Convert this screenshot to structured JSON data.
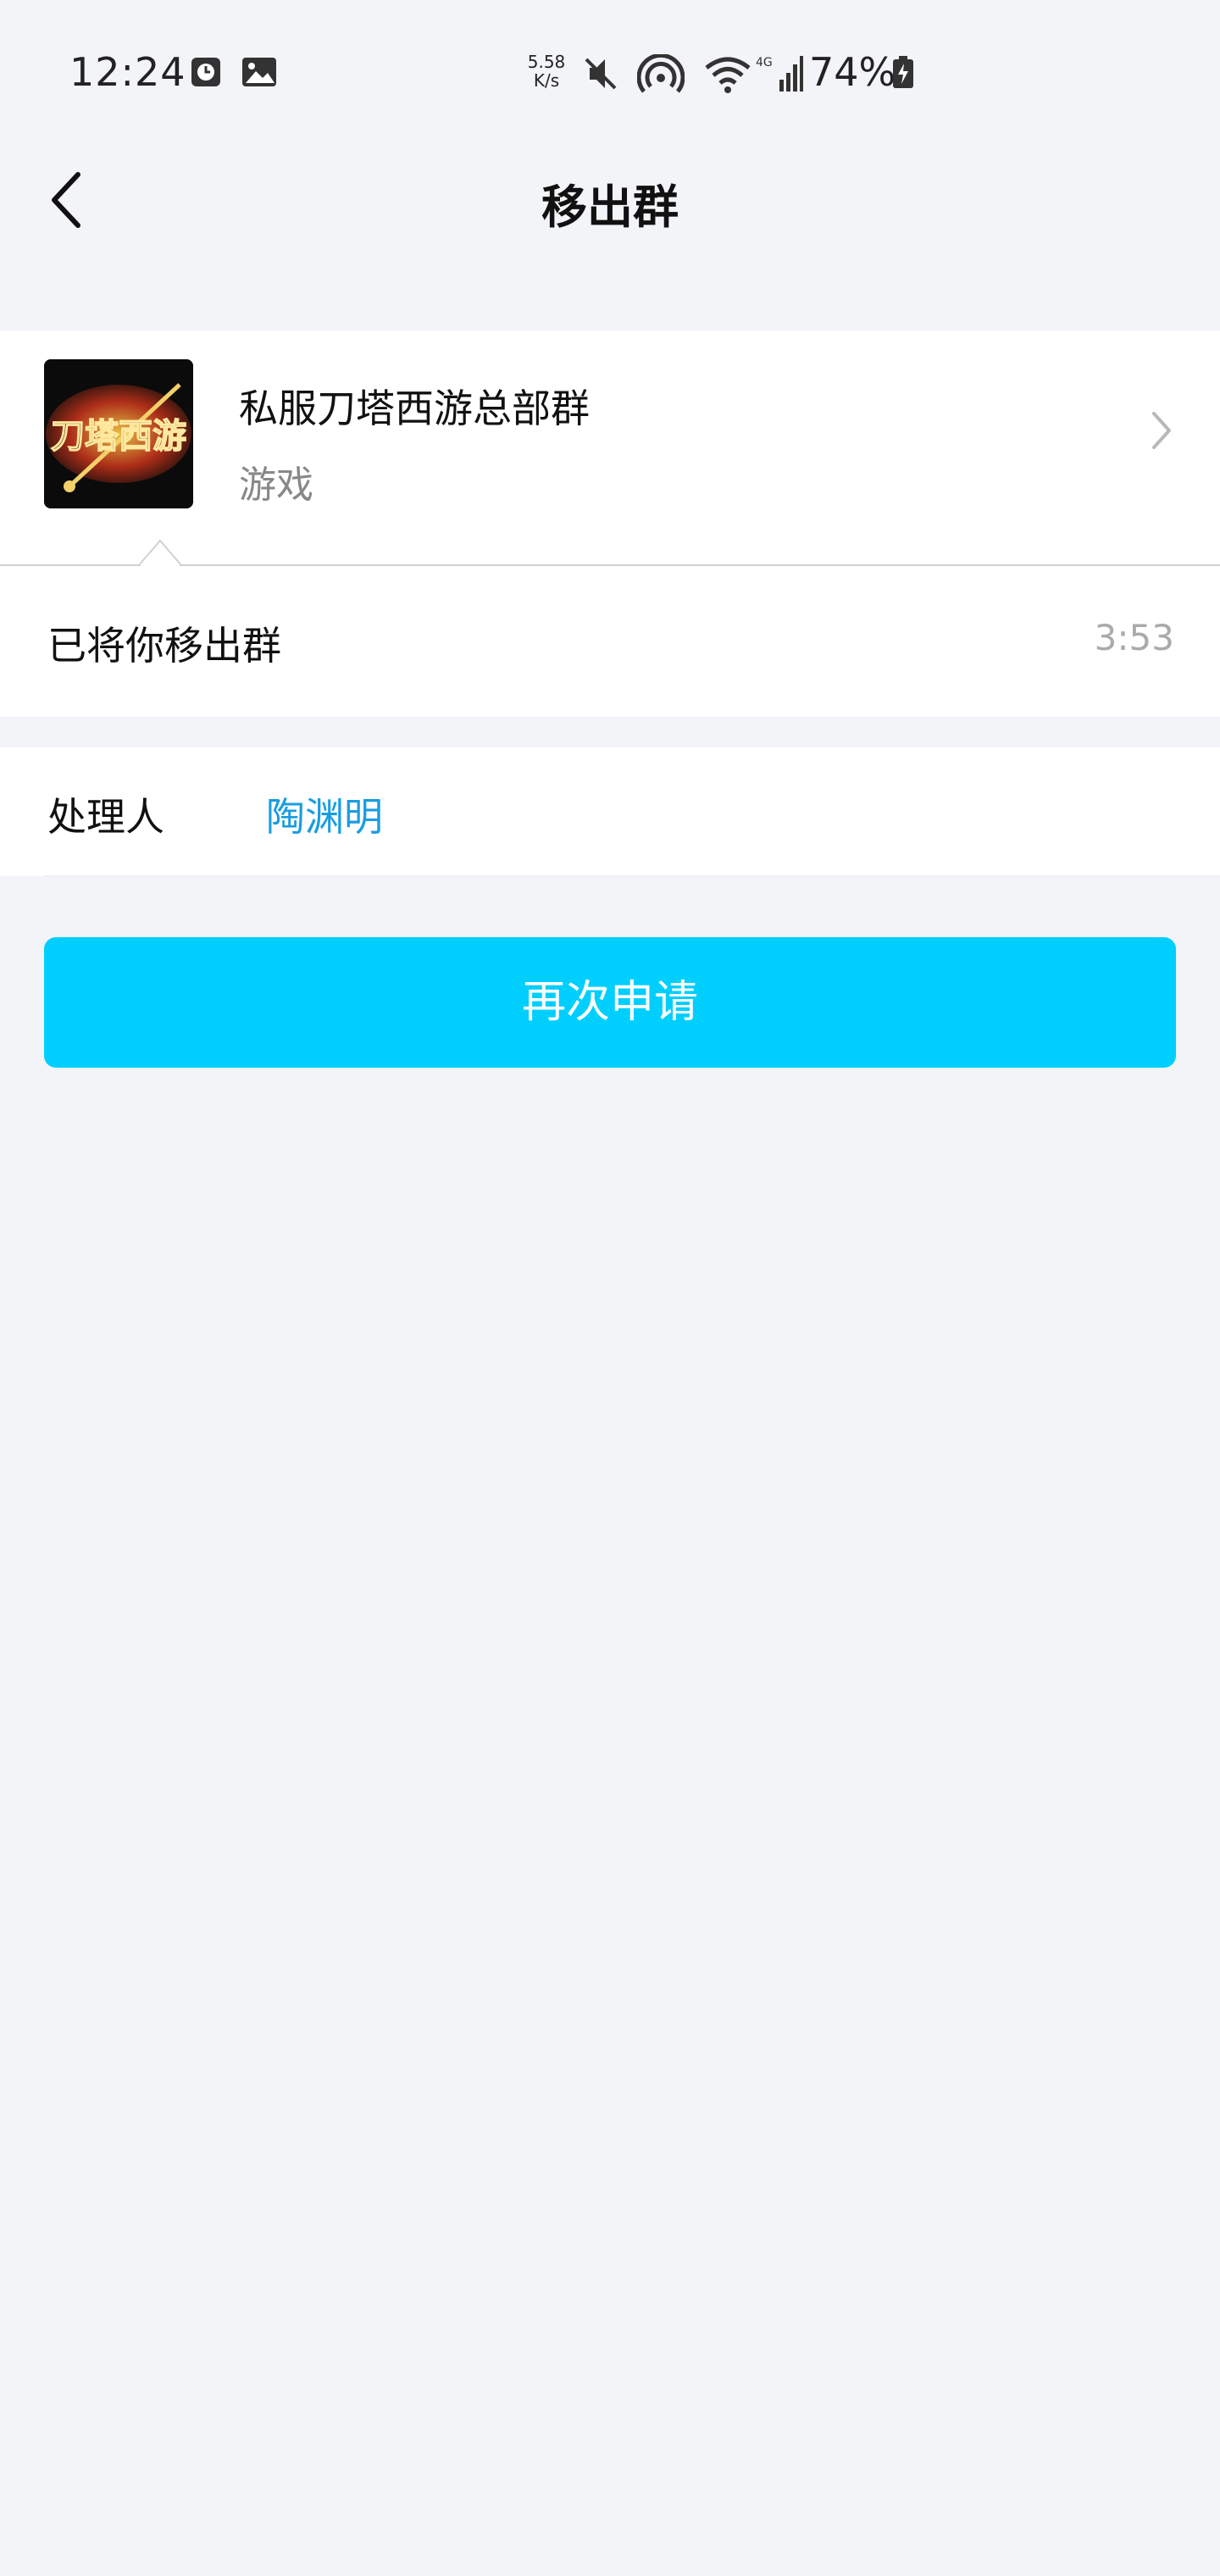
{
  "status_bar": {
    "time": "12:24",
    "net_speed_value": "5.58",
    "net_speed_unit": "K/s",
    "battery": "74%"
  },
  "nav": {
    "title": "移出群"
  },
  "group": {
    "name": "私服刀塔西游总部群",
    "category": "游戏",
    "avatar_text": "刀塔西游"
  },
  "notice": {
    "message": "已将你移出群",
    "time": "3:53"
  },
  "handler": {
    "label": "处理人",
    "name": "陶渊明"
  },
  "actions": {
    "reapply_label": "再次申请"
  },
  "colors": {
    "accent_button": "#00cffe",
    "handler_link": "#1a9de0",
    "background": "#f3f4f8"
  }
}
